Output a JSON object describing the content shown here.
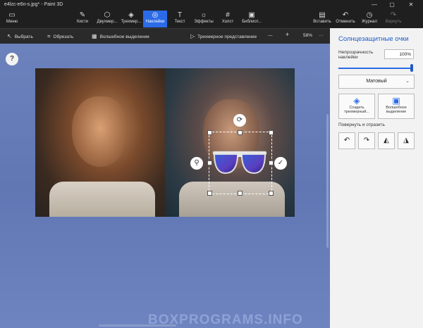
{
  "window": {
    "title": "e4lzc-e6n-s.jpg* - Paint 3D",
    "minimize": "—",
    "maximize": "▢",
    "close": "✕"
  },
  "toolbar": {
    "menu": "Меню",
    "brushes": "Кисти",
    "shapes2d": "Двухмер...",
    "shapes3d": "Трехмер...",
    "stickers": "Наклейки",
    "text": "Текст",
    "effects": "Эффекты",
    "canvas": "Холст",
    "library": "Библиот...",
    "paste": "Вставить",
    "undo": "Отменить",
    "history": "Журнал",
    "redo": "Вернуть"
  },
  "subbar": {
    "select": "Выбрать",
    "crop": "Обрезать",
    "magic_select": "Волшебное выделение",
    "view3d": "Трехмерное представление",
    "zoom_out": "—",
    "zoom_in": "+",
    "zoom": "58%",
    "more": "···"
  },
  "canvas": {
    "help": "?",
    "watermark": "BOXPROGRAMS.INFO"
  },
  "panel": {
    "title": "Солнцезащитные очки",
    "opacity_label": "Непрозрачность наклейки",
    "opacity_value": "100%",
    "opacity_level": 1.0,
    "finish": "Матовый",
    "make3d": "Создать трехмерный...",
    "magic": "Волшебное выделение",
    "rotate_label": "Повернуть и отразить"
  },
  "colors": {
    "accent": "#2b6be8",
    "panel_title": "#1f5cc7",
    "canvas_bg": "#6177b4"
  }
}
